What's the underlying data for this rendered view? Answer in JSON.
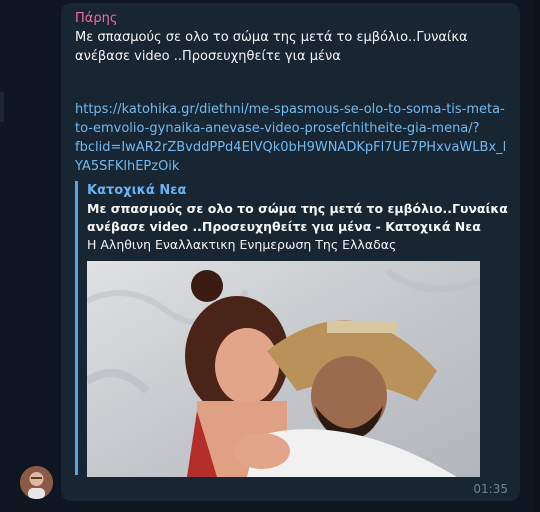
{
  "message": {
    "sender": "Πάρης",
    "text_lines": [
      "Με σπασμούς σε ολο το σώμα της μετά το εμβόλιο..Γυναίκα",
      "ανέβασε video ..Προσευχηθείτε για μένα"
    ],
    "link_lines": [
      "https://katohika.gr/diethni/me-spasmous-se-olo-to-soma-tis-meta-",
      "to-emvolio-gynaika-anevase-video-prosefchitheite-gia-mena/?",
      "fbclid=IwAR2rZBvddPPd4EIVQk0bH9WNADKpFl7UE7PHxvaWLBx_l",
      "YA5SFKlhEPzOik"
    ],
    "time": "01:35"
  },
  "preview": {
    "site_name": "Κατοχικά Νεα",
    "title_lines": [
      "Με σπασμούς σε ολο το σώμα της μετά το εμβόλιο..Γυναίκα",
      "ανέβασε video ..Προσευχηθείτε για μένα - Κατοχικά Νεα"
    ],
    "description": "Η Αληθινη Εναλλακτικη Ενημερωση Της Ελλαδας"
  },
  "colors": {
    "background": "#0e1621",
    "bubble": "#182533",
    "sender": "#ef6fa0",
    "link": "#71baf0",
    "accent_bar": "#5aa5df"
  }
}
